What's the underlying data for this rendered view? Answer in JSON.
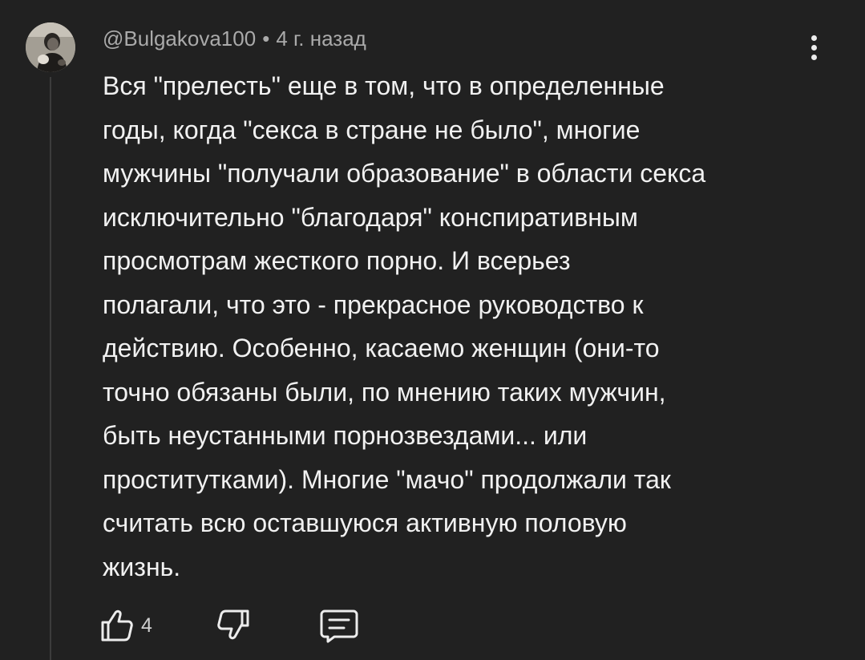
{
  "comment": {
    "author": "@Bulgakova100",
    "separator": "•",
    "timestamp": "4 г. назад",
    "text": "Вся \"прелесть\" еще в том, что в определенные\nгоды, когда \"секса в стране не было\", многие\nмужчины \"получали образование\" в области секса\nисключительно \"благодаря\" конспиративным\nпросмотрам жесткого порно. И всерьез\nполагали, что это - прекрасное руководство к\nдействию. Особенно, касаемо женщин (они-то\nточно обязаны были, по мнению таких мужчин,\nбыть неустанными порнозвездами... или\nпроститутками). Многие \"мачо\" продолжали так\nсчитать всю оставшуюся активную половую\nжизнь.",
    "like_count": "4"
  },
  "icons": {
    "avatar": "user-avatar-photo",
    "menu": "more-vertical-icon",
    "like": "thumbs-up-icon",
    "dislike": "thumbs-down-icon",
    "reply": "comment-reply-icon"
  },
  "colors": {
    "background": "#212121",
    "text": "#f1f1f1",
    "meta": "#aaaaaa",
    "thread_line": "#3c3c3c"
  }
}
